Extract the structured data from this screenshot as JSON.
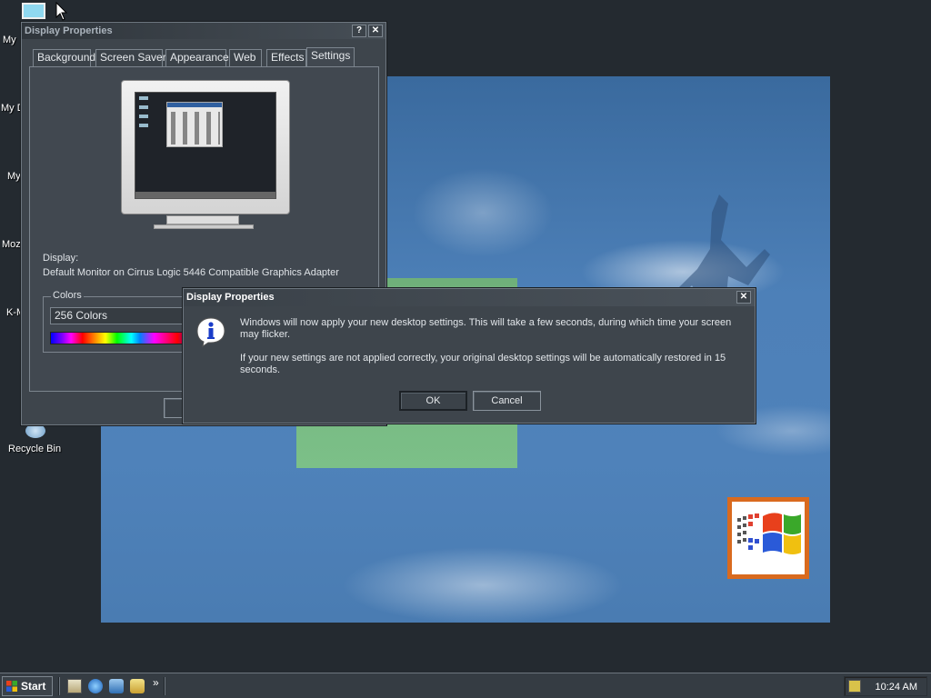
{
  "desktop": {
    "icons": [
      {
        "label": "My"
      },
      {
        "label": "My D"
      },
      {
        "label": "My"
      },
      {
        "label": "Moz"
      },
      {
        "label": "K-M"
      },
      {
        "label": "Recycle Bin"
      }
    ]
  },
  "display_properties": {
    "title": "Display Properties",
    "help_glyph": "?",
    "close_glyph": "✕",
    "tabs": [
      {
        "label": "Background"
      },
      {
        "label": "Screen Saver"
      },
      {
        "label": "Appearance"
      },
      {
        "label": "Web"
      },
      {
        "label": "Effects"
      },
      {
        "label": "Settings"
      }
    ],
    "active_tab": "Settings",
    "display_label": "Display:",
    "display_value": "Default Monitor on Cirrus Logic 5446 Compatible Graphics Adapter",
    "colors_group_label": "Colors",
    "colors_selected": "256 Colors"
  },
  "dialog": {
    "title": "Display Properties",
    "close_glyph": "✕",
    "icon": "info-icon",
    "message1": "Windows will now apply your new desktop settings. This will take a few seconds, during which time your screen may flicker.",
    "message2": "If your new settings are not applied correctly, your original desktop settings will be automatically restored in 15 seconds.",
    "ok_label": "OK",
    "cancel_label": "Cancel"
  },
  "taskbar": {
    "start_label": "Start",
    "clock": "10:24 AM",
    "chevron": "»"
  },
  "colors": {
    "desktop_bg": "#242a30",
    "window_bg": "#414850",
    "accent_orange": "#d96a1e"
  }
}
